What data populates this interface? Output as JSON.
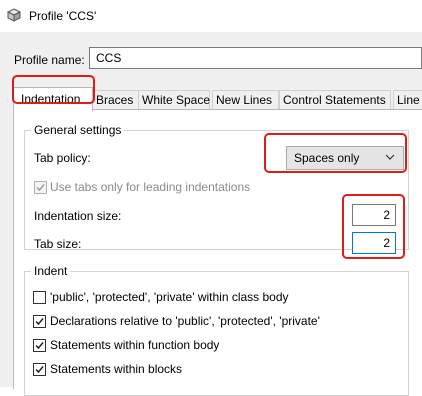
{
  "window": {
    "title": "Profile 'CCS'",
    "icon": "app-cube-icon"
  },
  "profile": {
    "label": "Profile name:",
    "value": "CCS"
  },
  "tabs": [
    "Indentation",
    "Braces",
    "White Space",
    "New Lines",
    "Control Statements",
    "Line"
  ],
  "active_tab": "Indentation",
  "general": {
    "title": "General settings",
    "tab_policy_label": "Tab policy:",
    "tab_policy_value": "Spaces only",
    "use_tabs_label": "Use tabs only for leading indentations",
    "use_tabs_checked": true,
    "use_tabs_enabled": false,
    "indent_size_label": "Indentation size:",
    "indent_size_value": "2",
    "tab_size_label": "Tab size:",
    "tab_size_value": "2"
  },
  "indent": {
    "title": "Indent",
    "items": [
      {
        "label": "'public', 'protected', 'private' within class body",
        "checked": false
      },
      {
        "label": "Declarations relative to 'public', 'protected', 'private'",
        "checked": true
      },
      {
        "label": "Statements within function body",
        "checked": true
      },
      {
        "label": "Statements within blocks",
        "checked": true
      }
    ]
  },
  "colors": {
    "highlight": "#e01b1b",
    "focus": "#0078d7"
  }
}
